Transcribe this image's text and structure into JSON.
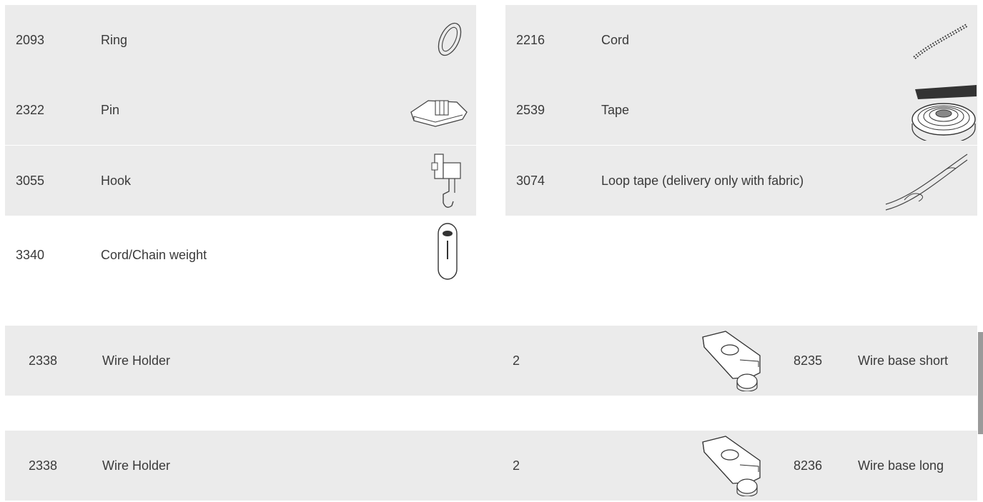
{
  "parts_grid": [
    {
      "number": "2093",
      "name": "Ring",
      "icon": "ring-icon"
    },
    {
      "number": "2216",
      "name": "Cord",
      "icon": "cord-icon"
    },
    {
      "number": "2322",
      "name": "Pin",
      "icon": "pin-icon"
    },
    {
      "number": "2539",
      "name": "Tape",
      "icon": "tape-roll-icon"
    },
    {
      "number": "3055",
      "name": "Hook",
      "icon": "hook-icon"
    },
    {
      "number": "3074",
      "name": "Loop tape (delivery only with fabric)",
      "icon": "loop-tape-icon"
    },
    {
      "number": "3340",
      "name": "Cord/Chain weight",
      "icon": "weight-icon"
    }
  ],
  "wire_rows": [
    {
      "number": "2338",
      "name": "Wire Holder",
      "qty": "2",
      "ref_number": "8235",
      "ref_name": "Wire base short",
      "icon": "wire-holder-icon"
    },
    {
      "number": "2338",
      "name": "Wire Holder",
      "qty": "2",
      "ref_number": "8236",
      "ref_name": "Wire base long",
      "icon": "wire-holder-icon"
    }
  ]
}
